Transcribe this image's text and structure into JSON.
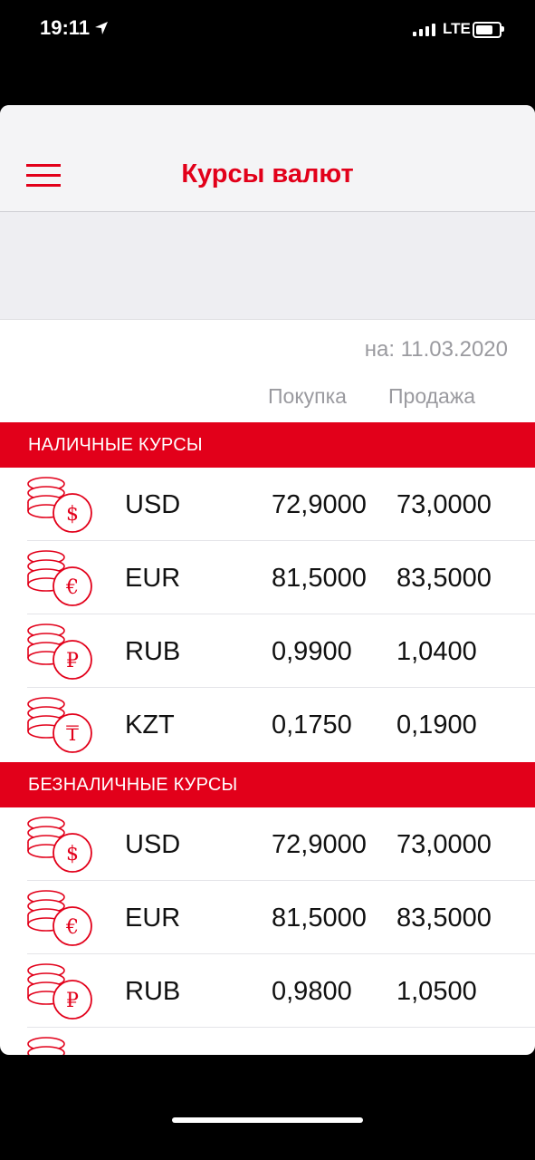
{
  "status_bar": {
    "time": "19:11",
    "network": "LTE"
  },
  "header": {
    "title": "Курсы валют"
  },
  "rates_meta": {
    "date_label": "на: 11.03.2020",
    "buy_label": "Покупка",
    "sell_label": "Продажа"
  },
  "sections": [
    {
      "title": "НАЛИЧНЫЕ КУРСЫ",
      "rows": [
        {
          "code": "USD",
          "symbol": "$",
          "buy": "72,9000",
          "sell": "73,0000"
        },
        {
          "code": "EUR",
          "symbol": "€",
          "buy": "81,5000",
          "sell": "83,5000"
        },
        {
          "code": "RUB",
          "symbol": "₽",
          "buy": "0,9900",
          "sell": "1,0400"
        },
        {
          "code": "KZT",
          "symbol": "₸",
          "buy": "0,1750",
          "sell": "0,1900"
        }
      ]
    },
    {
      "title": "БЕЗНАЛИЧНЫЕ КУРСЫ",
      "rows": [
        {
          "code": "USD",
          "symbol": "$",
          "buy": "72,9000",
          "sell": "73,0000"
        },
        {
          "code": "EUR",
          "symbol": "€",
          "buy": "81,5000",
          "sell": "83,5000"
        },
        {
          "code": "RUB",
          "symbol": "₽",
          "buy": "0,9800",
          "sell": "1,0500"
        }
      ]
    }
  ],
  "icons": {
    "coin": "coin-stack-icon",
    "menu": "hamburger-menu-icon"
  },
  "colors": {
    "accent": "#e2001a",
    "muted_text": "#9a9a9f"
  }
}
